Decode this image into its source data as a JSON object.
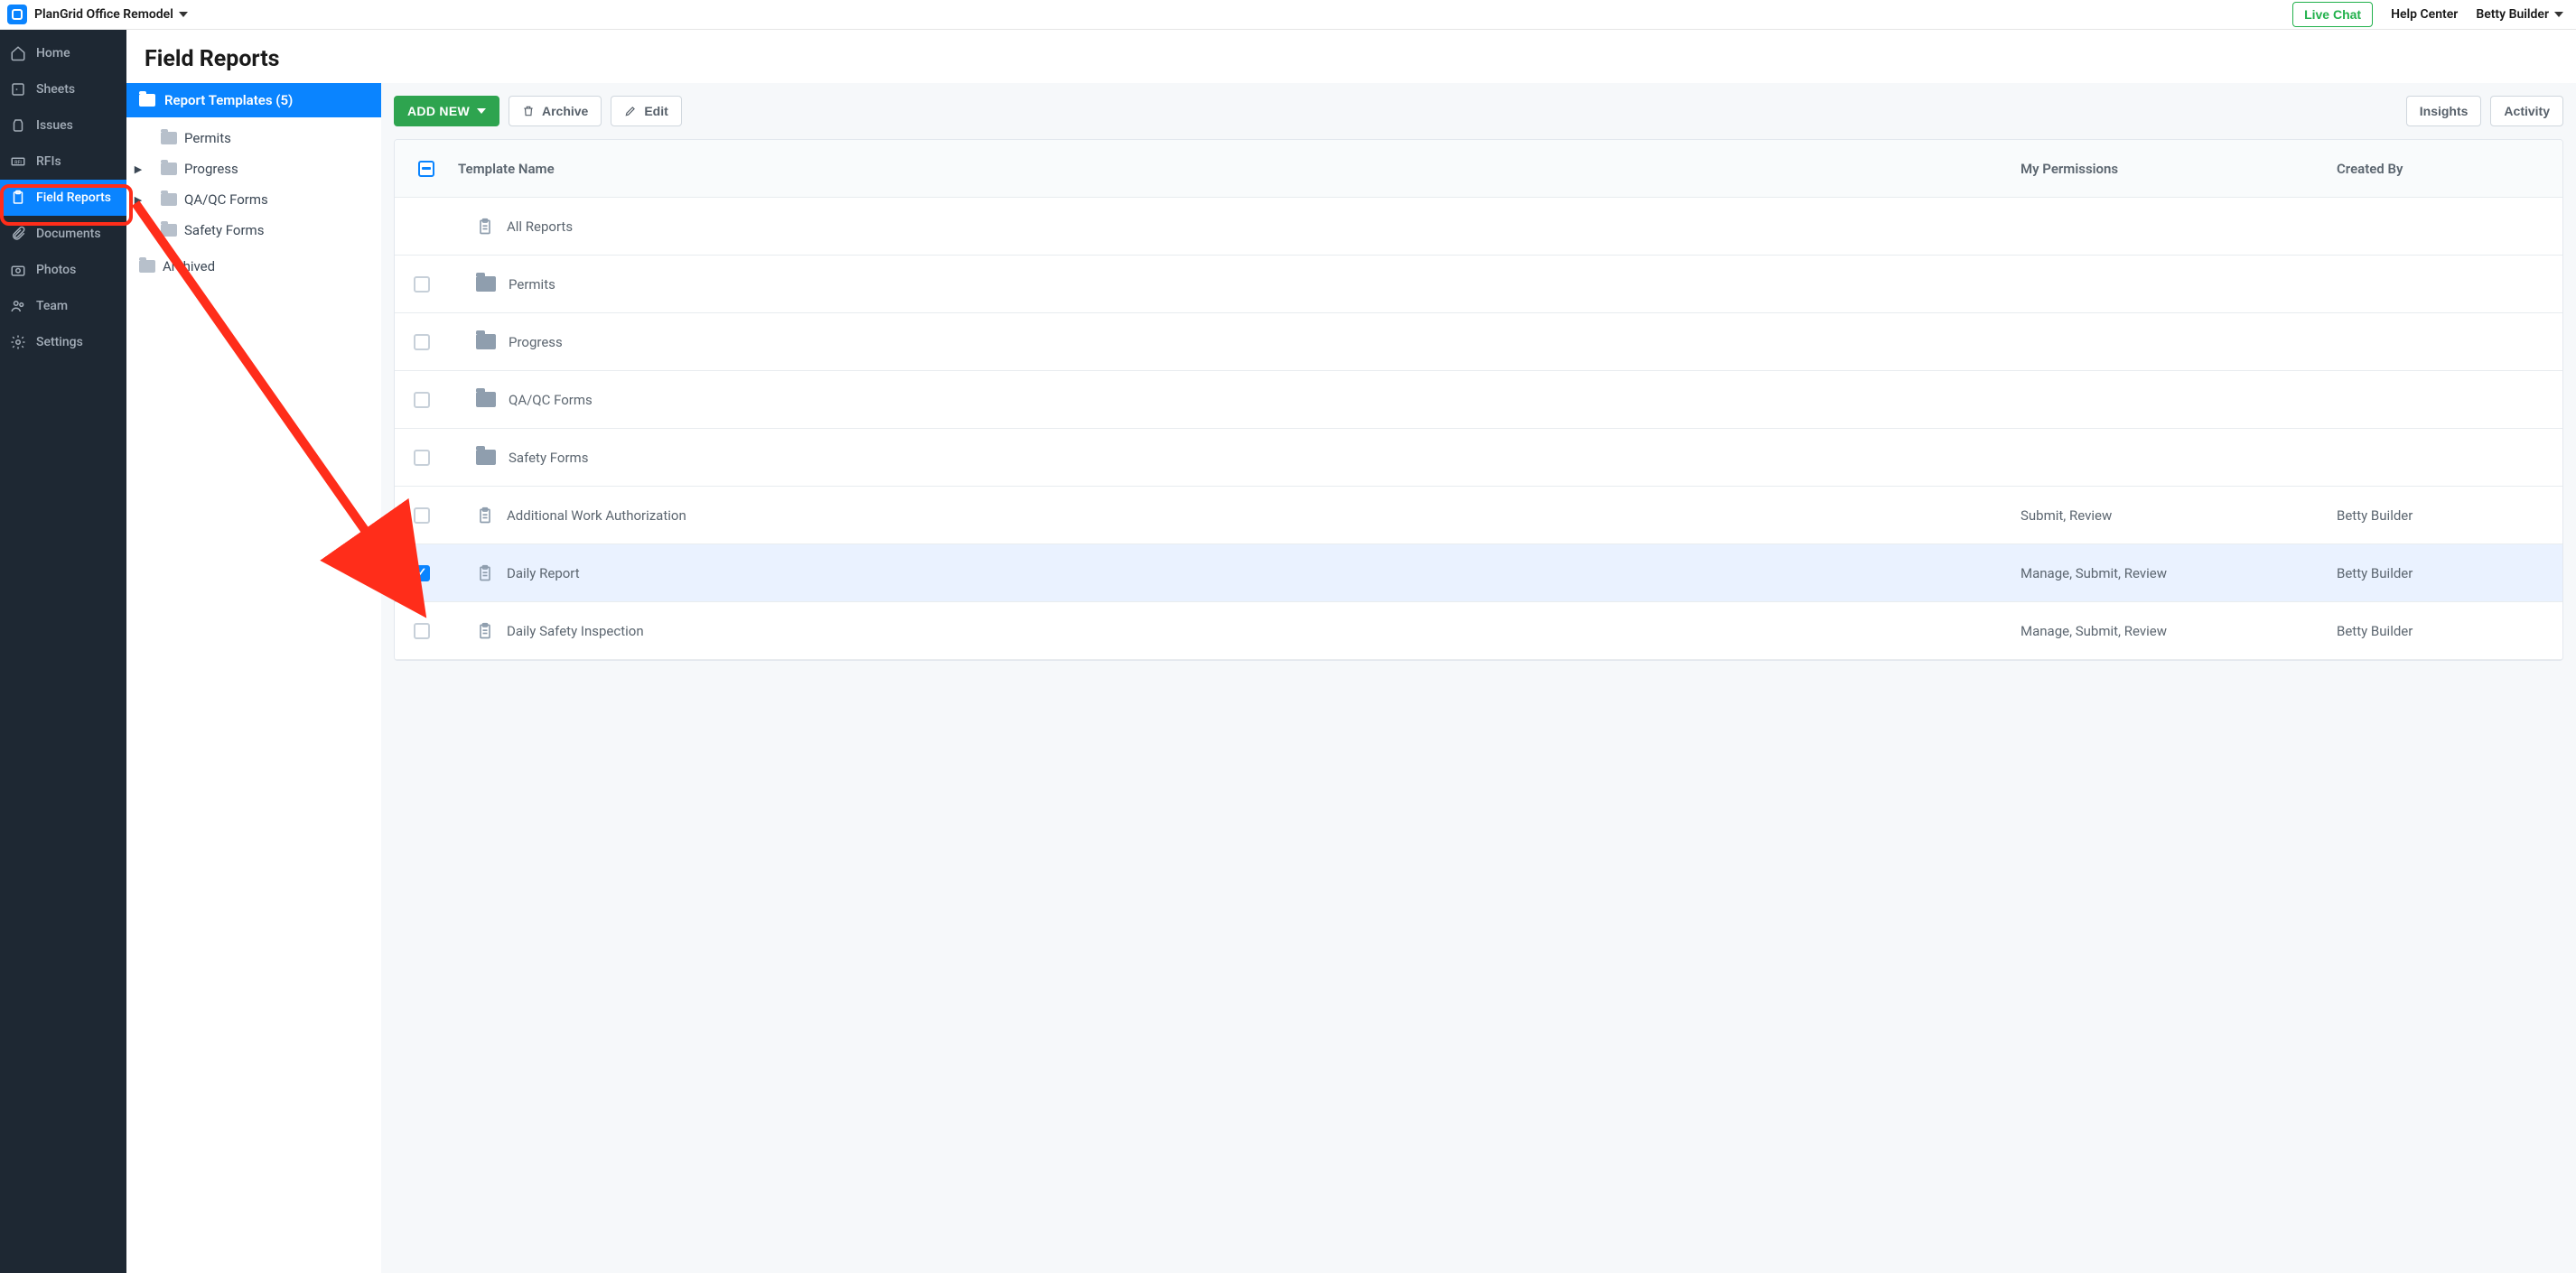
{
  "header": {
    "project": "PlanGrid Office Remodel",
    "live_chat": "Live Chat",
    "help_center": "Help Center",
    "user": "Betty Builder"
  },
  "sidebar": {
    "items": [
      {
        "label": "Home"
      },
      {
        "label": "Sheets"
      },
      {
        "label": "Issues"
      },
      {
        "label": "RFIs"
      },
      {
        "label": "Field Reports"
      },
      {
        "label": "Documents"
      },
      {
        "label": "Photos"
      },
      {
        "label": "Team"
      },
      {
        "label": "Settings"
      }
    ]
  },
  "page": {
    "title": "Field Reports"
  },
  "tree": {
    "root": "Report Templates (5)",
    "items": [
      {
        "label": "Permits",
        "expandable": false
      },
      {
        "label": "Progress",
        "expandable": true
      },
      {
        "label": "QA/QC Forms",
        "expandable": true
      },
      {
        "label": "Safety Forms",
        "expandable": false
      }
    ],
    "archived": "Archived"
  },
  "toolbar": {
    "add_new": "ADD NEW",
    "archive": "Archive",
    "edit": "Edit",
    "insights": "Insights",
    "activity": "Activity"
  },
  "table": {
    "columns": {
      "name": "Template Name",
      "perm": "My Permissions",
      "created": "Created By"
    },
    "rows": [
      {
        "type": "all",
        "name": "All Reports",
        "perm": "",
        "created": "",
        "checked": false
      },
      {
        "type": "folder",
        "name": "Permits",
        "perm": "",
        "created": "",
        "checked": false
      },
      {
        "type": "folder",
        "name": "Progress",
        "perm": "",
        "created": "",
        "checked": false
      },
      {
        "type": "folder",
        "name": "QA/QC Forms",
        "perm": "",
        "created": "",
        "checked": false
      },
      {
        "type": "folder",
        "name": "Safety Forms",
        "perm": "",
        "created": "",
        "checked": false
      },
      {
        "type": "report",
        "name": "Additional Work Authorization",
        "perm": "Submit, Review",
        "created": "Betty Builder",
        "checked": false
      },
      {
        "type": "report",
        "name": "Daily Report",
        "perm": "Manage, Submit, Review",
        "created": "Betty Builder",
        "checked": true
      },
      {
        "type": "report",
        "name": "Daily Safety Inspection",
        "perm": "Manage, Submit, Review",
        "created": "Betty Builder",
        "checked": false
      }
    ]
  }
}
